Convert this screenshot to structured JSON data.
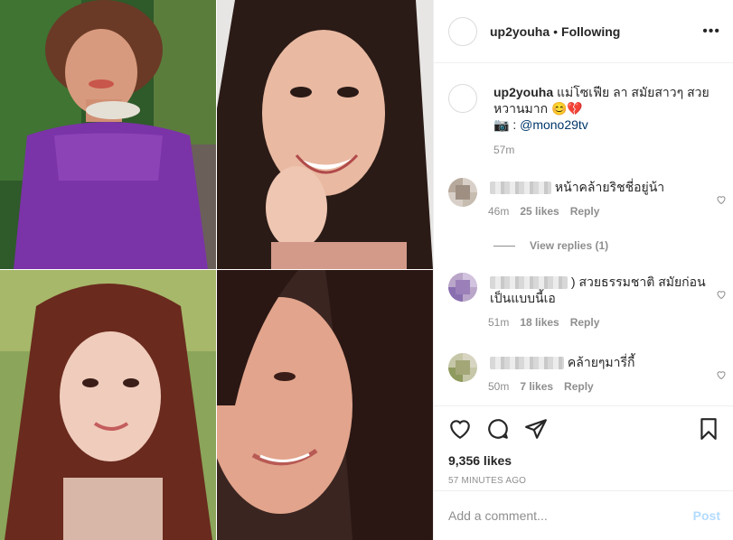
{
  "post": {
    "username": "up2youha",
    "follow_state": "Following",
    "separator": "•",
    "more_label": "•••",
    "caption_text": "แม่โซเฟีย ลา สมัยสาวๆ สวยหวานมาก",
    "caption_emoji": "😊💔",
    "camera_emoji": "📷",
    "caption_credit_prefix": ":",
    "caption_mention": "@mono29tv",
    "caption_time": "57m"
  },
  "comments": [
    {
      "text": "หน้าคล้ายริชชี่อยู่น้า",
      "time": "46m",
      "likes": "25 likes",
      "reply": "Reply"
    },
    {
      "text": ") สวยธรรมชาติ สมัยก่อนเป็นแบบนี้เอ",
      "time": "51m",
      "likes": "18 likes",
      "reply": "Reply"
    },
    {
      "text": "คล้ายๆมารี่กี้",
      "time": "50m",
      "likes": "7 likes",
      "reply": "Reply"
    }
  ],
  "view_replies": "View replies (1)",
  "likes_count": "9,356 likes",
  "posted_ago": "57 MINUTES AGO",
  "comment_box": {
    "placeholder": "Add a comment...",
    "post_label": "Post"
  },
  "icons": [
    "heart-icon",
    "comment-icon",
    "share-icon",
    "bookmark-icon"
  ],
  "colors": {
    "mention": "#00376b",
    "post_disabled": "#b3dbff",
    "muted": "#8e8e8e"
  }
}
